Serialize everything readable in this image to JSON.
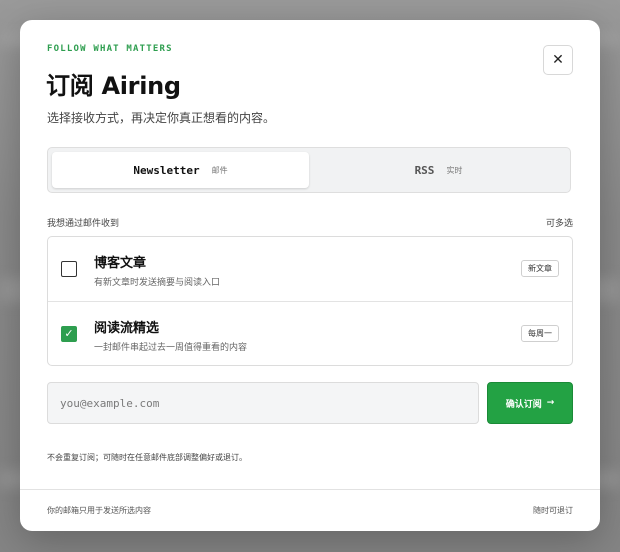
{
  "header": {
    "eyebrow": "FOLLOW WHAT MATTERS",
    "title": "订阅 Airing",
    "subtitle": "选择接收方式，再决定你真正想看的内容。",
    "close_icon": "close-icon"
  },
  "tabs": [
    {
      "label": "Newsletter",
      "sub": "邮件",
      "active": true
    },
    {
      "label": "RSS",
      "sub": "实时",
      "active": false
    }
  ],
  "options_section": {
    "label": "我想通过邮件收到",
    "hint": "可多选",
    "items": [
      {
        "title": "博客文章",
        "desc": "有新文章时发送摘要与阅读入口",
        "badge": "新文章",
        "checked": false
      },
      {
        "title": "阅读流精选",
        "desc": "一封邮件串起过去一周值得重看的内容",
        "badge": "每周一",
        "checked": true
      }
    ]
  },
  "form": {
    "email_placeholder": "you@example.com",
    "email_value": "",
    "submit_label": "确认订阅",
    "submit_icon": "→"
  },
  "note": "不会重复订阅；可随时在任意邮件底部调整偏好或退订。",
  "footer": {
    "left": "你的邮箱只用于发送所选内容",
    "right": "随时可退订"
  },
  "colors": {
    "accent": "#2e9e4f",
    "button": "#23a244"
  }
}
